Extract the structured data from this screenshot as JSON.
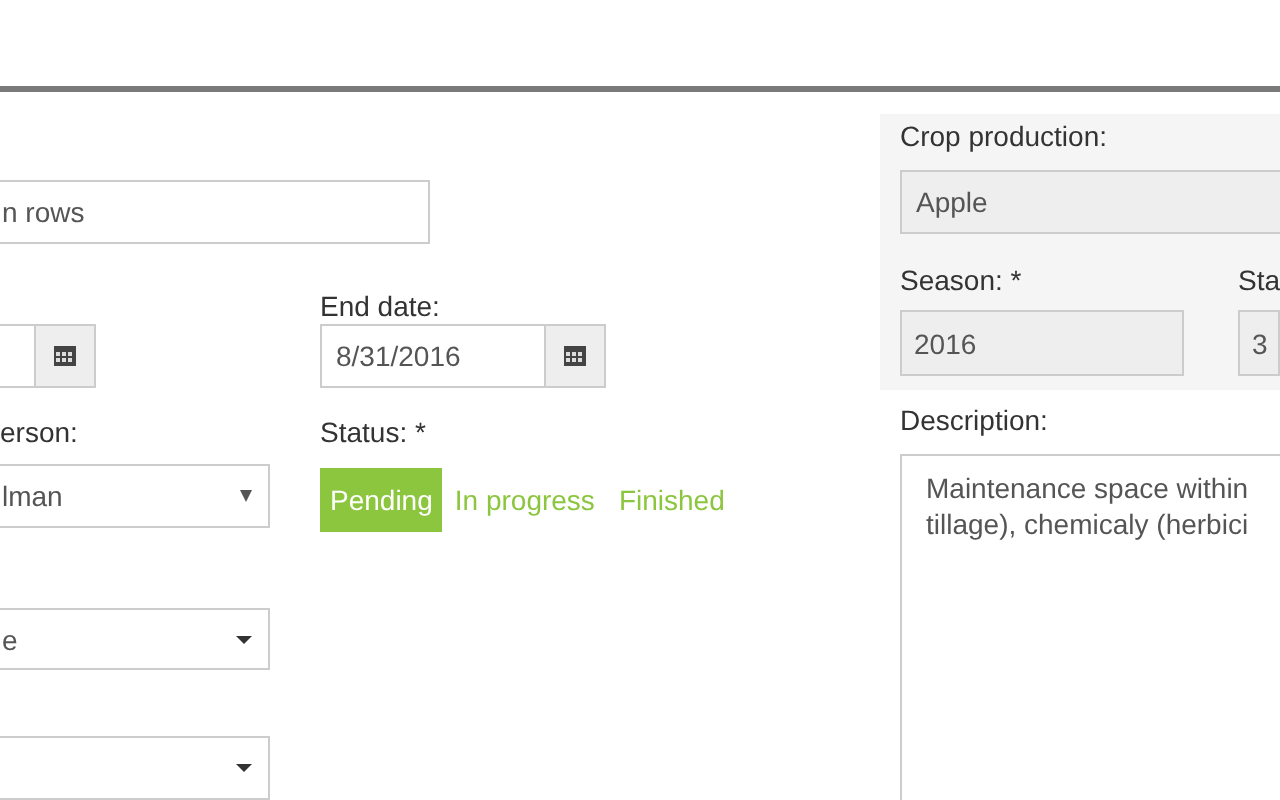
{
  "name_field": {
    "value": "n rows"
  },
  "end_date": {
    "label": "End date:",
    "value": "8/31/2016"
  },
  "person": {
    "label": "erson:",
    "value": "lman"
  },
  "status": {
    "label": "Status: *",
    "options": [
      {
        "label": "Pending",
        "selected": true
      },
      {
        "label": "In progress",
        "selected": false
      },
      {
        "label": "Finished",
        "selected": false
      }
    ]
  },
  "select_2": {
    "value": "e"
  },
  "crop_production": {
    "label": "Crop production:",
    "value": "Apple"
  },
  "season": {
    "label": "Season: *",
    "value": "2016"
  },
  "column_2": {
    "label": "Sta",
    "value": "3"
  },
  "description": {
    "label": "Description:",
    "lines": [
      "Maintenance space within",
      "tillage), chemicaly (herbici"
    ]
  }
}
